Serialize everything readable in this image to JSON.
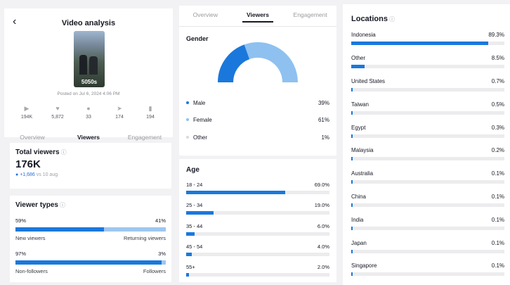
{
  "header": {
    "back_icon": "back-arrow-icon",
    "title": "Video analysis"
  },
  "video": {
    "thumb_label": "5050s",
    "posted": "Posted on Jul 6, 2024 4:06 PM"
  },
  "stats": [
    {
      "icon": "play-icon",
      "value": "194K"
    },
    {
      "icon": "heart-icon",
      "value": "5,872"
    },
    {
      "icon": "comment-icon",
      "value": "33"
    },
    {
      "icon": "share-icon",
      "value": "174"
    },
    {
      "icon": "bookmark-icon",
      "value": "194"
    }
  ],
  "tabs": [
    "Overview",
    "Viewers",
    "Engagement"
  ],
  "active_tab": "Viewers",
  "total_viewers": {
    "title": "Total viewers",
    "value": "176K",
    "delta": "+1,686",
    "delta_suffix": "vs 10 aug"
  },
  "viewer_types": {
    "title": "Viewer types",
    "rows": [
      {
        "left_pct": "59%",
        "right_pct": "41%",
        "fraction": 0.59,
        "left_label": "New viewers",
        "right_label": "Returning viewers"
      },
      {
        "left_pct": "97%",
        "right_pct": "3%",
        "fraction": 0.97,
        "left_label": "Non-followers",
        "right_label": "Followers"
      }
    ]
  },
  "gender": {
    "title": "Gender",
    "items": [
      {
        "label": "Male",
        "value": "39%",
        "fraction": 0.39,
        "color": "#1a78dc"
      },
      {
        "label": "Female",
        "value": "61%",
        "fraction": 0.61,
        "color": "#8ec1f0"
      },
      {
        "label": "Other",
        "value": "1%",
        "fraction": 0.01,
        "color": "#d8d9dc"
      }
    ]
  },
  "age": {
    "title": "Age",
    "rows": [
      {
        "label": "18 - 24",
        "value": "69.0%",
        "fraction": 0.69
      },
      {
        "label": "25 - 34",
        "value": "19.0%",
        "fraction": 0.19
      },
      {
        "label": "35 - 44",
        "value": "6.0%",
        "fraction": 0.06
      },
      {
        "label": "45 - 54",
        "value": "4.0%",
        "fraction": 0.04
      },
      {
        "label": "55+",
        "value": "2.0%",
        "fraction": 0.02
      }
    ]
  },
  "locations": {
    "title": "Locations",
    "rows": [
      {
        "label": "Indonesia",
        "value": "89.3%",
        "fraction": 0.893
      },
      {
        "label": "Other",
        "value": "8.5%",
        "fraction": 0.085
      },
      {
        "label": "United States",
        "value": "0.7%",
        "fraction": 0.007
      },
      {
        "label": "Taiwan",
        "value": "0.5%",
        "fraction": 0.005
      },
      {
        "label": "Egypt",
        "value": "0.3%",
        "fraction": 0.003
      },
      {
        "label": "Malaysia",
        "value": "0.2%",
        "fraction": 0.002
      },
      {
        "label": "Australia",
        "value": "0.1%",
        "fraction": 0.001
      },
      {
        "label": "China",
        "value": "0.1%",
        "fraction": 0.001
      },
      {
        "label": "India",
        "value": "0.1%",
        "fraction": 0.001
      },
      {
        "label": "Japan",
        "value": "0.1%",
        "fraction": 0.001
      },
      {
        "label": "Singapore",
        "value": "0.1%",
        "fraction": 0.001
      }
    ]
  }
}
